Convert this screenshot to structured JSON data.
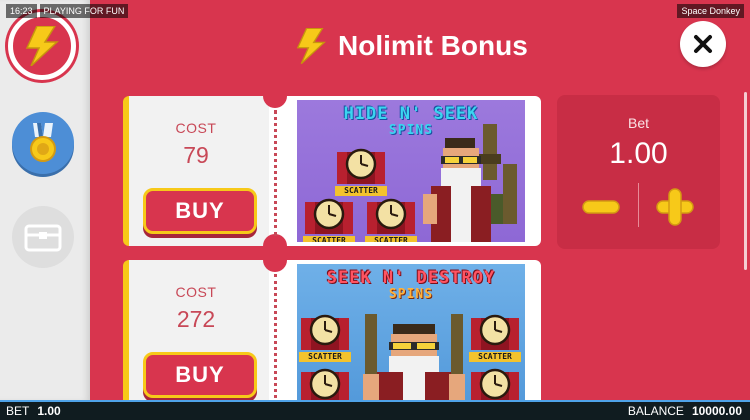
{
  "status": {
    "time": "16:23",
    "mode": "PLAYING FOR FUN",
    "game_name": "Space Donkey"
  },
  "header": {
    "title": "Nolimit Bonus",
    "icon": "lightning-icon"
  },
  "sidebar": {
    "items": [
      {
        "name": "bonus",
        "icon": "lightning-icon",
        "active": true
      },
      {
        "name": "medal",
        "icon": "medal-icon",
        "active": false
      },
      {
        "name": "chest",
        "icon": "chest-icon",
        "active": false
      }
    ]
  },
  "offers": [
    {
      "cost_label": "COST",
      "cost": "79",
      "buy_label": "BUY",
      "art_title_1": "HIDE N' SEEK",
      "art_title_2": "SPINS",
      "symbol_label": "SCATTER"
    },
    {
      "cost_label": "COST",
      "cost": "272",
      "buy_label": "BUY",
      "art_title_1": "SEEK N' DESTROY",
      "art_title_2": "SPINS",
      "symbol_label": "SCATTER"
    }
  ],
  "bet_panel": {
    "label": "Bet",
    "value": "1.00"
  },
  "footer": {
    "bet_label": "BET",
    "bet_value": "1.00",
    "balance_label": "BALANCE",
    "balance_value": "10000.00"
  },
  "colors": {
    "background": "#d8354e",
    "accent": "#f7c919",
    "panel": "#c82d45",
    "footer": "#101c20"
  }
}
